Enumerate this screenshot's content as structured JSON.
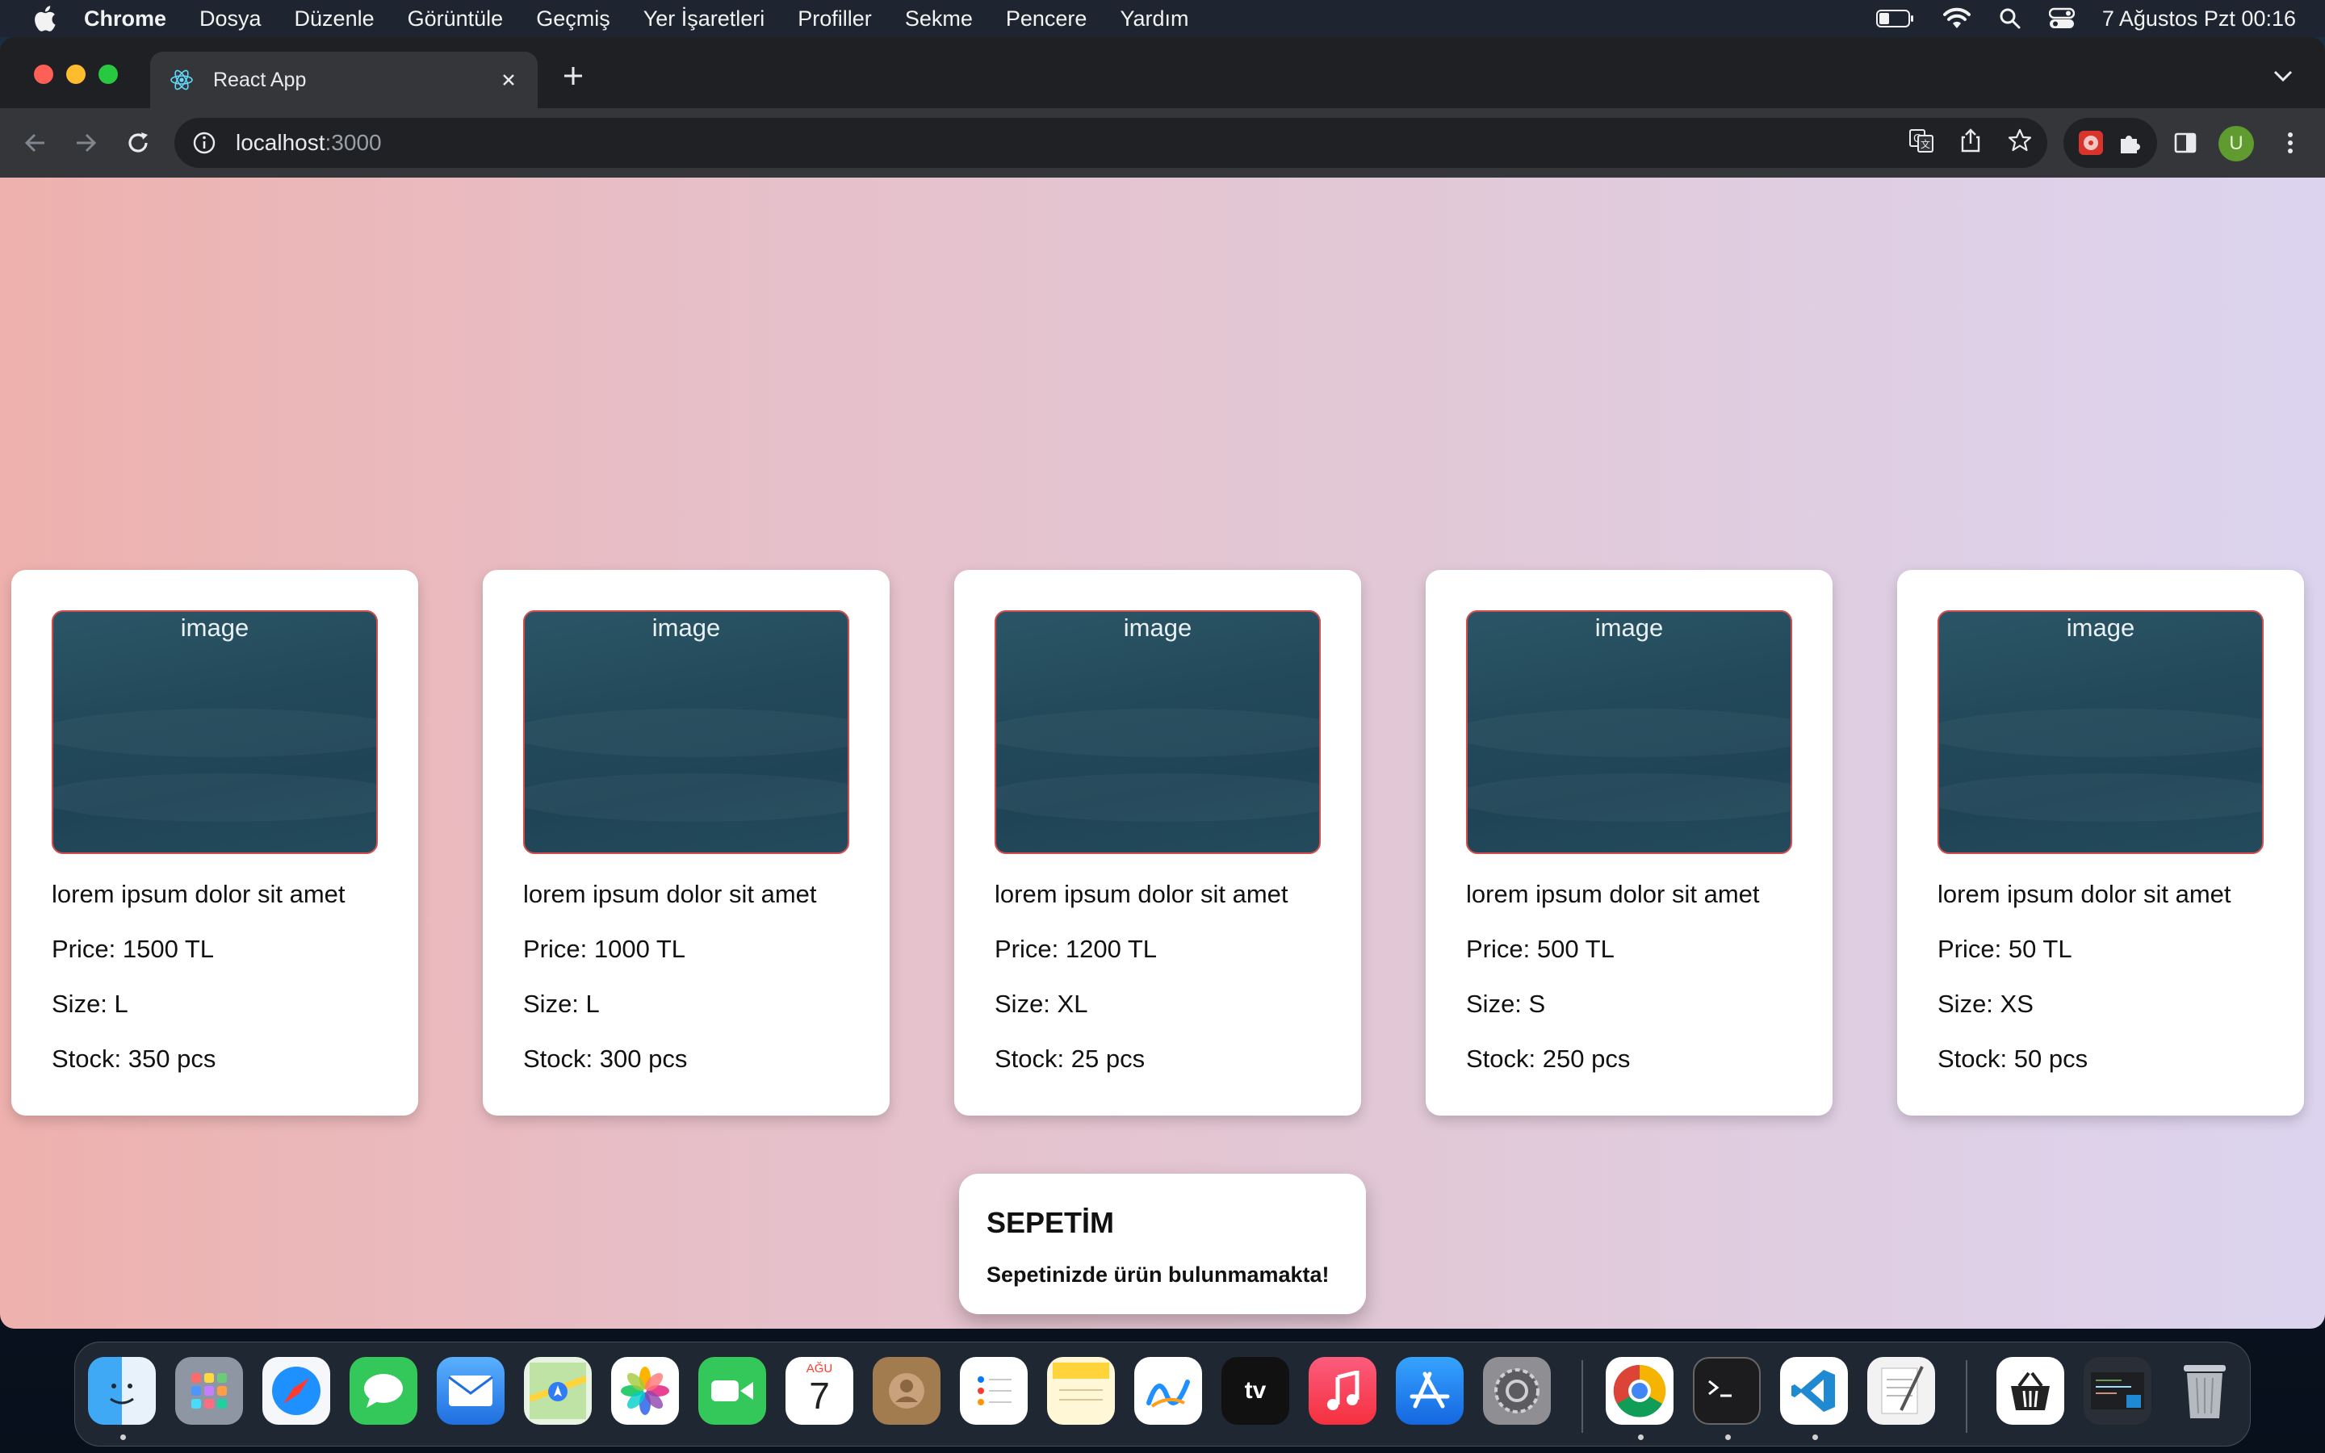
{
  "menubar": {
    "app_name": "Chrome",
    "items": [
      "Dosya",
      "Düzenle",
      "Görüntüle",
      "Geçmiş",
      "Yer İşaretleri",
      "Profiller",
      "Sekme",
      "Pencere",
      "Yardım"
    ],
    "clock": "7 Ağustos Pzt  00:16"
  },
  "browser": {
    "tab_title": "React App",
    "url_host": "localhost",
    "url_port": ":3000",
    "profile_initial": "U"
  },
  "products": [
    {
      "image_label": "image",
      "title": "lorem ipsum dolor sit amet",
      "price": "Price: 1500 TL",
      "size": "Size: L",
      "stock": "Stock: 350 pcs"
    },
    {
      "image_label": "image",
      "title": "lorem ipsum dolor sit amet",
      "price": "Price: 1000 TL",
      "size": "Size: L",
      "stock": "Stock: 300 pcs"
    },
    {
      "image_label": "image",
      "title": "lorem ipsum dolor sit amet",
      "price": "Price: 1200 TL",
      "size": "Size: XL",
      "stock": "Stock: 25 pcs"
    },
    {
      "image_label": "image",
      "title": "lorem ipsum dolor sit amet",
      "price": "Price: 500 TL",
      "size": "Size: S",
      "stock": "Stock: 250 pcs"
    },
    {
      "image_label": "image",
      "title": "lorem ipsum dolor sit amet",
      "price": "Price: 50 TL",
      "size": "Size: XS",
      "stock": "Stock: 50 pcs"
    }
  ],
  "cart": {
    "title": "SEPETİM",
    "empty_message": "Sepetinizde ürün bulunmamakta!"
  },
  "dock": {
    "calendar_month": "AĞU",
    "calendar_day": "7",
    "tv_label": "tv"
  },
  "colors": {
    "page_gradient_left": "#eeb1ad",
    "page_gradient_right": "#dcd4ef",
    "image_border": "#d64b4b",
    "card_bg": "#ffffff"
  }
}
